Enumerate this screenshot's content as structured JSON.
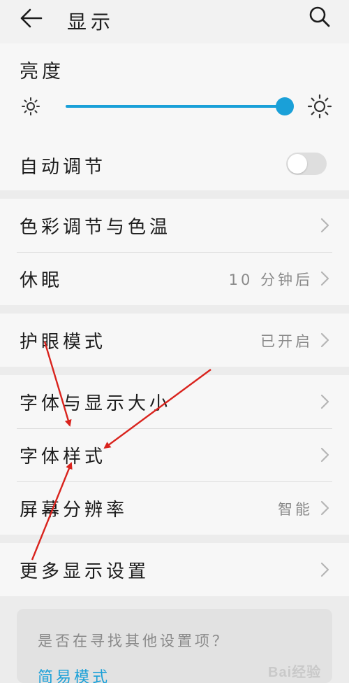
{
  "header": {
    "title": "显示",
    "back_icon": "back-arrow-icon",
    "search_icon": "search-icon"
  },
  "brightness": {
    "label": "亮度",
    "level_fraction": 0.97,
    "accent_color": "#1aa0d8",
    "auto_label": "自动调节",
    "auto_enabled": false
  },
  "group2": {
    "items": [
      {
        "label": "色彩调节与色温",
        "value": ""
      },
      {
        "label": "休眠",
        "value": "10 分钟后"
      }
    ]
  },
  "group3": {
    "items": [
      {
        "label": "护眼模式",
        "value": "已开启"
      }
    ]
  },
  "group4": {
    "items": [
      {
        "label": "字体与显示大小",
        "value": ""
      },
      {
        "label": "字体样式",
        "value": ""
      },
      {
        "label": "屏幕分辨率",
        "value": "智能"
      }
    ]
  },
  "group5": {
    "items": [
      {
        "label": "更多显示设置",
        "value": ""
      }
    ]
  },
  "suggestion": {
    "question": "是否在寻找其他设置项？",
    "link": "简易模式"
  },
  "watermark": "Bai经验"
}
